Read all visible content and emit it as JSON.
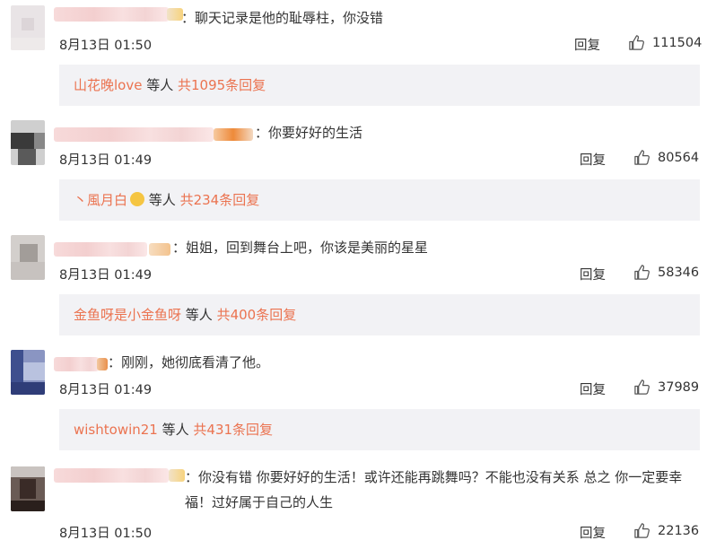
{
  "comments": [
    {
      "text": "：聊天记录是他的耻辱柱，你没错",
      "time": "8月13日 01:50",
      "reply_label": "回复",
      "likes": "111504",
      "sub": {
        "user": "山花晚love",
        "mid": " 等人 ",
        "count": "共1095条回复"
      }
    },
    {
      "text": "：你要好好的生活",
      "time": "8月13日 01:49",
      "reply_label": "回复",
      "likes": "80564",
      "sub": {
        "user": "丶風月白",
        "mid": " 等人 ",
        "count": "共234条回复"
      }
    },
    {
      "text": "：姐姐，回到舞台上吧，你该是美丽的星星",
      "time": "8月13日 01:49",
      "reply_label": "回复",
      "likes": "58346",
      "sub": {
        "user": "金鱼呀是小金鱼呀",
        "mid": " 等人 ",
        "count": "共400条回复"
      }
    },
    {
      "text": "：刚刚，她彻底看清了他。",
      "time": "8月13日 01:49",
      "reply_label": "回复",
      "likes": "37989",
      "sub": {
        "user": "wishtowin21",
        "mid": " 等人 ",
        "count": "共431条回复"
      }
    },
    {
      "text": "：你没有错 你要好好的生活！或许还能再跳舞吗？不能也没有关系 总之 你一定要幸福！过好属于自己的人生",
      "time": "8月13日 01:50",
      "reply_label": "回复",
      "likes": "22136"
    }
  ],
  "colors": {
    "link": "#eb7350",
    "sub_bg": "#f2f2f5",
    "text": "#333333"
  }
}
